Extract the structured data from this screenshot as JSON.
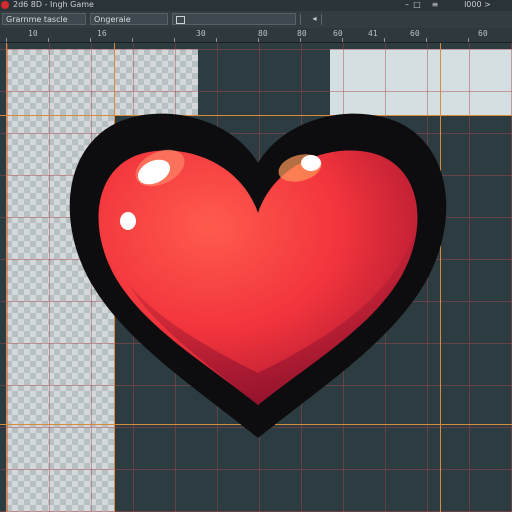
{
  "window": {
    "title": "2d6 8D - Ingh Game",
    "title_right": "  l000 >"
  },
  "toolbar": {
    "field1": "Grarnme tascle",
    "field2": "Ongeraie",
    "field3": ""
  },
  "ruler": {
    "labels": [
      "10",
      "16",
      "30",
      "80",
      "80",
      "60",
      "60",
      "41",
      "60"
    ]
  },
  "colors": {
    "heart_fill": "#f2343c",
    "heart_outline": "#0d0d0f",
    "guide": "#d98a3a",
    "grid": "#aa4650"
  },
  "icons": {
    "title_dot": "record-dot-icon",
    "min": "minimize-icon",
    "max": "maximize-icon",
    "arrow": "arrow-left-icon"
  }
}
